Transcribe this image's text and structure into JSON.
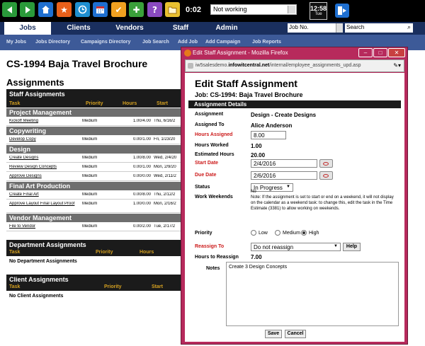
{
  "toolbar": {
    "icons": [
      "back-arrow-icon",
      "forward-arrow-icon",
      "home-icon",
      "favorite-star-icon",
      "clock-icon",
      "calendar-icon",
      "tasks-checkbox-icon",
      "add-plus-icon",
      "help-question-icon",
      "folder-icon"
    ],
    "timer": "0:02",
    "status_value": "Not working",
    "clock_time": "12:58",
    "clock_day": "Tue"
  },
  "nav": {
    "tabs": [
      "Jobs",
      "Clients",
      "Vendors",
      "Staff",
      "Admin"
    ],
    "jobno_value": "Job No.",
    "search_value": "Search"
  },
  "subnav": [
    "My Jobs",
    "Jobs Directory",
    "Campaigns Directory",
    "Job Search",
    "Add Job",
    "Add Campaign",
    "Job Reports"
  ],
  "page": {
    "title": "CS-1994 Baja Travel Brochure",
    "assignments_heading": "Assignments",
    "staff": {
      "title": "Staff Assignments",
      "columns": [
        "Task",
        "Priority",
        "Hours",
        "Start"
      ],
      "categories": [
        {
          "name": "Project Management",
          "rows": [
            [
              "Kickoff Meeting",
              "Medium",
              "1.00/4.00",
              "Thu, 6/16/2"
            ]
          ]
        },
        {
          "name": "Copywriting",
          "rows": [
            [
              "Develop Copy",
              "Medium",
              "0.00/1.00",
              "Fri, 1/23/20"
            ]
          ]
        },
        {
          "name": "Design",
          "rows": [
            [
              "Create Designs",
              "Medium",
              "1.00/8.00",
              "Wed, 2/4/20"
            ],
            [
              "Review Design Concepts",
              "Medium",
              "0.00/1.00",
              "Mon, 2/9/20"
            ],
            [
              "Approve Designs",
              "Medium",
              "0.00/0.00",
              "Wed, 2/11/2"
            ]
          ]
        },
        {
          "name": "Final Art Production",
          "rows": [
            [
              "Create Final Art",
              "Medium",
              "0.00/8.00",
              "Thu, 2/12/2"
            ],
            [
              "Approve Layout Final Layout Proof",
              "Medium",
              "1.00/0.00",
              "Mon, 2/16/2"
            ]
          ]
        },
        {
          "name": "Vendor Management",
          "rows": [
            [
              "File to Vendor",
              "Medium",
              "0.00/2.00",
              "Tue, 2/17/2"
            ]
          ]
        }
      ]
    },
    "department": {
      "title": "Department Assignments",
      "columns": [
        "Task",
        "Priority",
        "Hours"
      ],
      "empty": "No Department Assignments"
    },
    "client": {
      "title": "Client Assignments",
      "columns": [
        "Task",
        "Priority",
        "Start"
      ],
      "empty": "No Client Assignments"
    }
  },
  "popup": {
    "window_title": "Edit Staff Assignment - Mozilla Firefox",
    "url_host": "iw5salesdemo.",
    "url_domain": "infowitcentral.net",
    "url_path": "/internal/employee_assignments_upd.asp",
    "form_title": "Edit Staff Assignment",
    "job_line": "Job:  CS-1994:  Baja Travel Brochure",
    "details_title": "Assignment Details",
    "assignment_label": "Assignment",
    "assignment_value": "Design - Create Designs",
    "assigned_to_label": "Assigned To",
    "assigned_to_value": "Alice Anderson",
    "hours_assigned_label": "Hours Assigned",
    "hours_assigned_value": "8.00",
    "hours_worked_label": "Hours Worked",
    "hours_worked_value": "1.00",
    "estimated_hours_label": "Estimated Hours",
    "estimated_hours_value": "20.00",
    "start_date_label": "Start Date",
    "start_date_value": "2/4/2016",
    "due_date_label": "Due Date",
    "due_date_value": "2/6/2016",
    "status_label": "Status",
    "status_value": "In Progress",
    "weekends_label": "Work Weekends",
    "weekends_value": "No",
    "weekends_note": "Note: If the assignment is set to start or end on a weekend, it will not display on the calendar as a weekend task: to change this, edit the task in the Time Estimate (3381) to allow working on weekends.",
    "priority_label": "Priority",
    "priority_options": [
      "Low",
      "Medium",
      "High"
    ],
    "priority_selected": "High",
    "reassign_label": "Reassign To",
    "reassign_value": "Do not reassign",
    "help_label": "Help",
    "hours_reassign_label": "Hours to Reassign",
    "hours_reassign_value": "7.00",
    "notes_label": "Notes",
    "notes_value": "Create 3 Design Concepts",
    "save_label": "Save",
    "cancel_label": "Cancel"
  }
}
